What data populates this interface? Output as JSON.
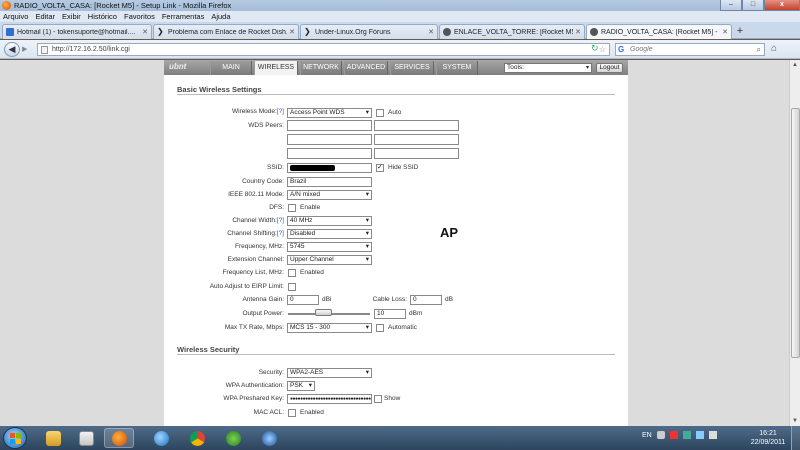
{
  "window": {
    "title": "RADIO_VOLTA_CASA: [Rocket M5] - Setup Link - Mozilla Firefox",
    "min": "–",
    "max": "□",
    "close": "x"
  },
  "menu": [
    "Arquivo",
    "Editar",
    "Exibir",
    "Histórico",
    "Favoritos",
    "Ferramentas",
    "Ajuda"
  ],
  "tabs": [
    {
      "label": "Hotmail (1) - tokensuporte@hotmail....",
      "icon": "mail-icon"
    },
    {
      "label": "Problema com Enlace de Rocket Dish...",
      "icon": "forum-icon"
    },
    {
      "label": "Under-Linux.Org Fóruns",
      "icon": "forum-icon"
    },
    {
      "label": "ENLACE_VOLTA_TORRE: [Rocket M5]",
      "icon": "ubnt-icon"
    },
    {
      "label": "RADIO_VOLTA_CASA: [Rocket M5] - ...",
      "icon": "ubnt-icon"
    }
  ],
  "nav": {
    "url": "http://172.16.2.50/link.cgi",
    "search_placeholder": "Google",
    "search_engine": "G"
  },
  "router": {
    "logo": "ubnt",
    "tabs": [
      "MAIN",
      "WIRELESS",
      "NETWORK",
      "ADVANCED",
      "SERVICES",
      "SYSTEM"
    ],
    "tools": "Tools:",
    "logout": "Logout"
  },
  "basic": {
    "title": "Basic Wireless Settings",
    "wireless_mode_label": "Wireless Mode:",
    "help": "[?]",
    "wireless_mode": "Access Point WDS",
    "auto": "Auto",
    "wds_peers_label": "WDS Peers:",
    "ssid_label": "SSID:",
    "hide_ssid": "Hide SSID",
    "country_label": "Country Code:",
    "country": "Brazil",
    "ieee_label": "IEEE 802.11 Mode:",
    "ieee": "A/N mixed",
    "dfs_label": "DFS:",
    "dfs": "Enable",
    "channel_width_label": "Channel Width:",
    "channel_width": "40 MHz",
    "channel_shifting_label": "Channel Shifting:",
    "channel_shifting": "Disabled",
    "frequency_label": "Frequency, MHz:",
    "frequency": "5745",
    "extension_label": "Extension Channel:",
    "extension": "Upper Channel",
    "freq_list_label": "Frequency List, MHz:",
    "freq_list": "Enabled",
    "eirp_label": "Auto Adjust to EIRP Limit:",
    "antenna_gain_label": "Antenna Gain:",
    "antenna_gain": "0",
    "dbi": "dBi",
    "cable_loss_label": "Cable Loss:",
    "cable_loss": "0",
    "db": "dB",
    "output_power_label": "Output Power:",
    "output_power": "10",
    "dbm": "dBm",
    "max_tx_label": "Max TX Rate, Mbps:",
    "max_tx": "MCS 15 - 300",
    "automatic": "Automatic"
  },
  "security": {
    "title": "Wireless Security",
    "security_label": "Security:",
    "security": "WPA2-AES",
    "wpa_auth_label": "WPA Authentication:",
    "wpa_auth": "PSK",
    "psk_label": "WPA Preshared Key:",
    "psk": "●●●●●●●●●●●●●●●●●●●●●●●●●●●●●●●●●●●●●●",
    "show": "Show",
    "mac_acl_label": "MAC ACL:",
    "mac_acl": "Enabled"
  },
  "annotation": "AP",
  "taskbar": {
    "lang": "EN",
    "time": "16:21",
    "date": "22/09/2011"
  }
}
